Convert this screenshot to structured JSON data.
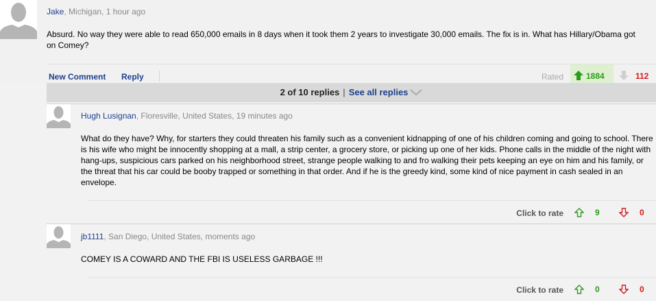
{
  "main_comment": {
    "user": "Jake",
    "meta": ", Michigan, 1 hour ago",
    "text": "Absurd. No way they were able to read 650,000 emails in 8 days when it took them 2 years to investigate 30,000 emails. The fix is in. What has Hillary/Obama got on Comey?",
    "new_comment_label": "New Comment",
    "reply_label": "Reply",
    "rated_label": "Rated",
    "up_votes": "1884",
    "down_votes": "112"
  },
  "replies_bar": {
    "count_text": "2 of 10 replies",
    "separator": "|",
    "see_all_label": "See all replies"
  },
  "replies": [
    {
      "user": "Hugh Lusignan",
      "meta": ", Floresville, United States, 19 minutes ago",
      "text": "What do they have? Why, for starters they could threaten his family such as a convenient kidnapping of one of his children coming and going to school. There is his wife who might be innocently shopping at a mall, a strip center, a grocery store, or picking up one of her kids. Phone calls in the middle of the night with hang-ups, suspicious cars parked on his neighborhood street, strange people walking to and fro walking their pets keeping an eye on him and his family, or the threat that his car could be booby trapped or something in that order. And if he is the greedy kind, some kind of nice payment in cash sealed in an envelope.",
      "click_to_rate": "Click to rate",
      "up_votes": "9",
      "down_votes": "0"
    },
    {
      "user": "jb1111",
      "meta": ", San Diego, United States, moments ago",
      "text": "COMEY IS A COWARD AND THE FBI IS USELESS GARBAGE !!!",
      "click_to_rate": "Click to rate",
      "up_votes": "0",
      "down_votes": "0"
    }
  ],
  "colors": {
    "link": "#1c3f8c",
    "up": "#2e9b1e",
    "down": "#d11b1b",
    "rated_up_bg": "#def0d0"
  }
}
